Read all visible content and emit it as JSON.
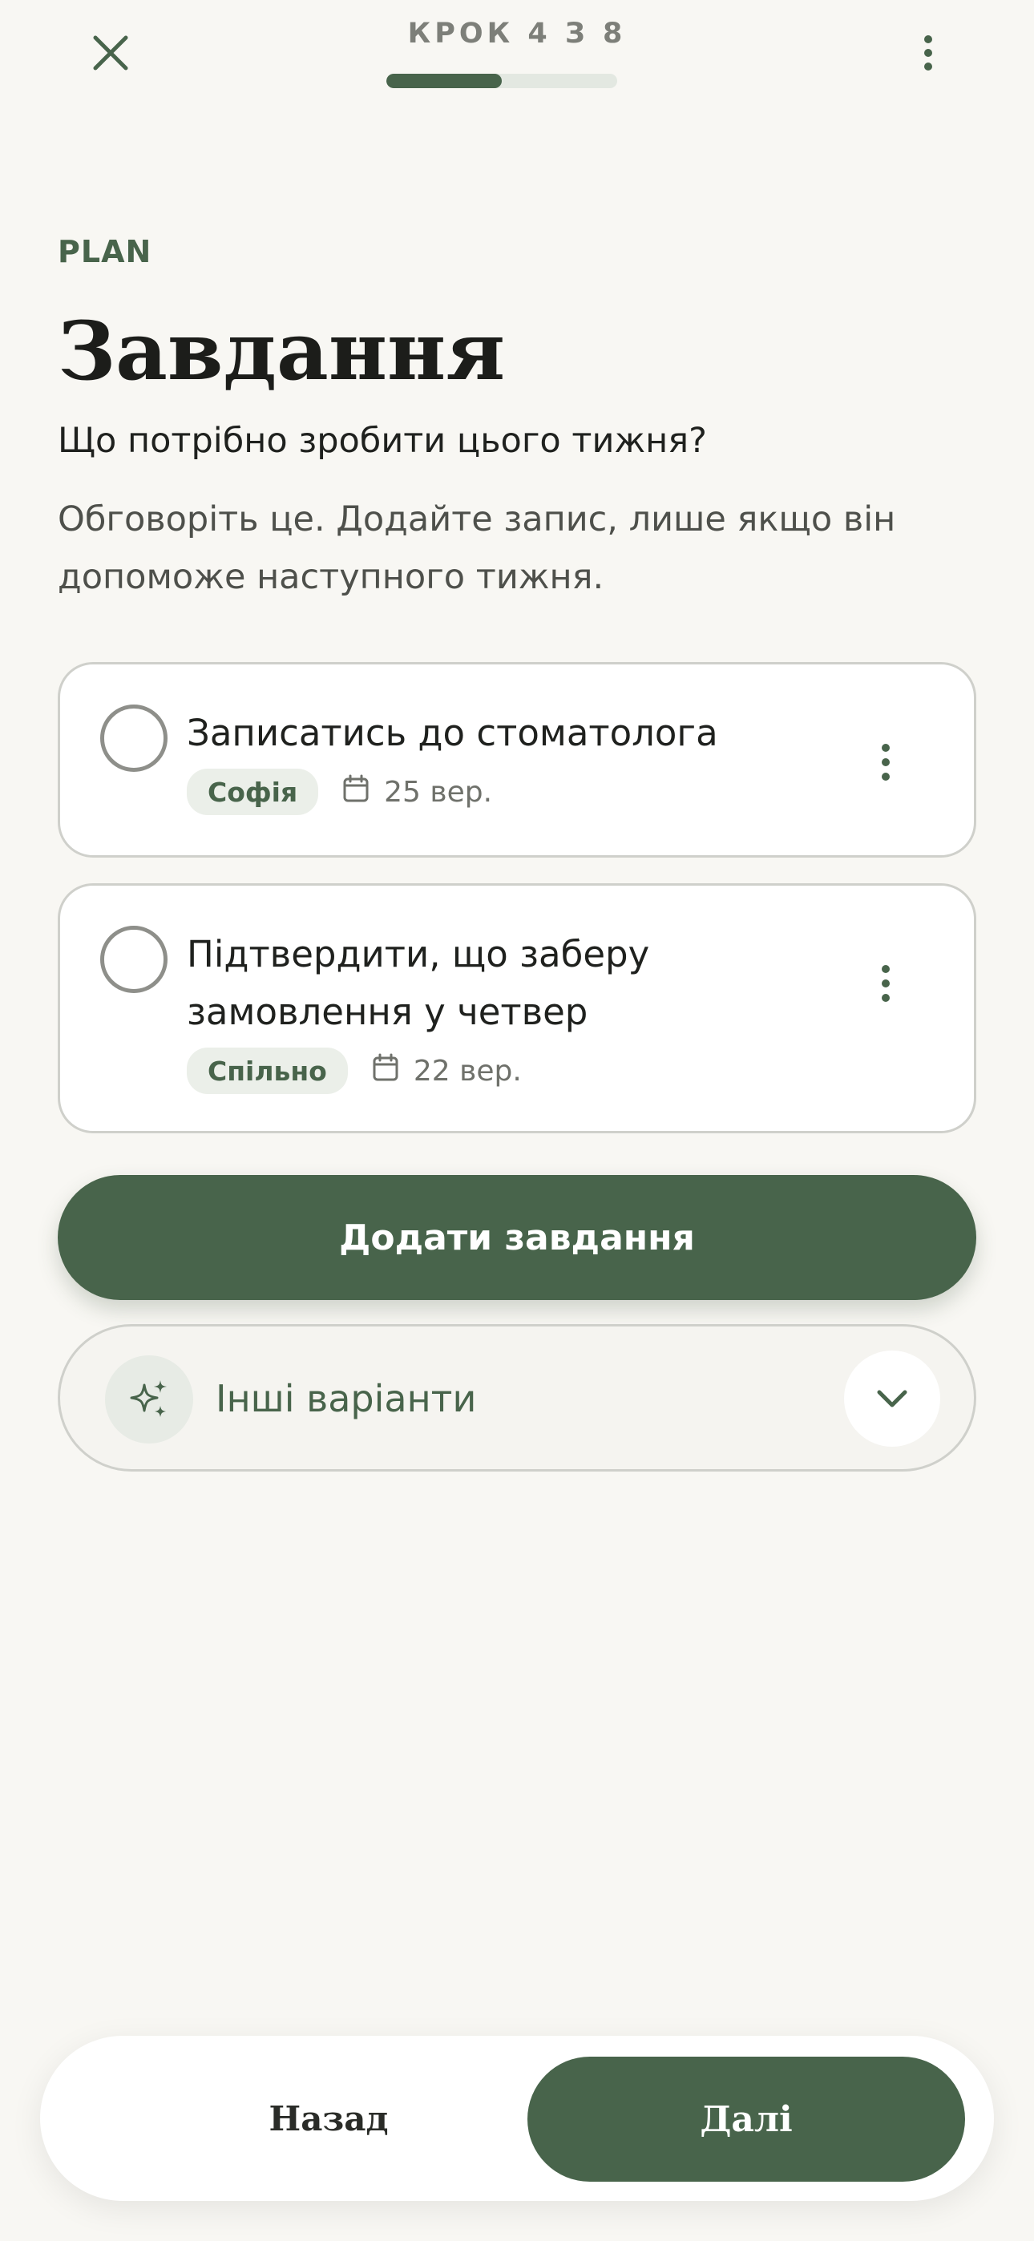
{
  "header": {
    "step_label": "КРОК 4 З 8",
    "progress": 0.5
  },
  "eyebrow": "PLAN",
  "title": "Завдання",
  "subtitle": "Що потрібно зробити цього тижня?",
  "hint": "Обговоріть це. Додайте запис, лише якщо він допоможе наступного тижня.",
  "tasks": [
    {
      "title": "Записатись до стоматолога",
      "assignee": "Софія",
      "due": "25 вер."
    },
    {
      "title": "Підтвердити, що заберу замовлення у четвер",
      "assignee": "Спільно",
      "due": "22 вер."
    }
  ],
  "actions": {
    "add_task": "Додати завдання",
    "other_options": "Інші варіанти"
  },
  "footer": {
    "back": "Назад",
    "next": "Далі"
  },
  "colors": {
    "accent": "#48644b",
    "background": "#f8f7f3"
  },
  "icons": [
    "close-icon",
    "more-vertical-icon",
    "calendar-icon",
    "sparkle-icon",
    "chevron-down-icon"
  ]
}
